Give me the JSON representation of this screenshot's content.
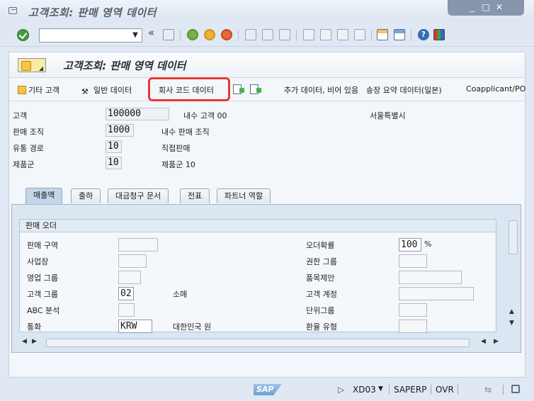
{
  "window": {
    "title": "고객조회: 판매 영역 데이터",
    "controls": [
      "_",
      "□",
      "✕"
    ]
  },
  "toolbar": {
    "command_value": "",
    "back_glyph": "«"
  },
  "header": {
    "title": "고객조회: 판매 영역 데이터"
  },
  "buttons": {
    "other_customer": "기타 고객",
    "general_data": "일반 데이터",
    "company_code_data": "회사 코드 데이터",
    "additional_data": "추가 데이터, 비어 있음",
    "invoice_summary": "송장 요약 데이터(일본)",
    "coapplicant": "Coapplicant/PO"
  },
  "form": {
    "customer_label": "고객",
    "customer_value": "100000",
    "customer_desc": "내수 고객 00",
    "customer_city": "서울특별시",
    "sales_org_label": "판매 조직",
    "sales_org_value": "1000",
    "sales_org_desc": "내수 판매 조직",
    "dist_channel_label": "유통 경로",
    "dist_channel_value": "10",
    "dist_channel_desc": "직접판매",
    "division_label": "제품군",
    "division_value": "10",
    "division_desc": "제품군 10"
  },
  "tabs": [
    "매출액",
    "출하",
    "대금청구 문서",
    "전표",
    "파트너 역할"
  ],
  "sales_order": {
    "group_title": "판매 오더",
    "sales_district_label": "판매 구역",
    "sales_office_label": "사업장",
    "sales_group_label": "영업 그룹",
    "customer_group_label": "고객 그룹",
    "customer_group_value": "02",
    "customer_group_desc": "소매",
    "abc_label": "ABC 분석",
    "currency_label": "통화",
    "currency_value": "KRW",
    "currency_desc": "대한민국 원",
    "order_prob_label": "오더확률",
    "order_prob_value": "100",
    "order_prob_unit": "%",
    "auth_group_label": "권한 그룹",
    "item_proposal_label": "품목제안",
    "acct_assign_label": "고객 계정",
    "unit_group_label": "단위그룹",
    "exch_rate_label": "환율 유형"
  },
  "status": {
    "tcode": "XD03",
    "system": "SAPERP",
    "mode": "OVR",
    "sap_logo": "SAP"
  }
}
